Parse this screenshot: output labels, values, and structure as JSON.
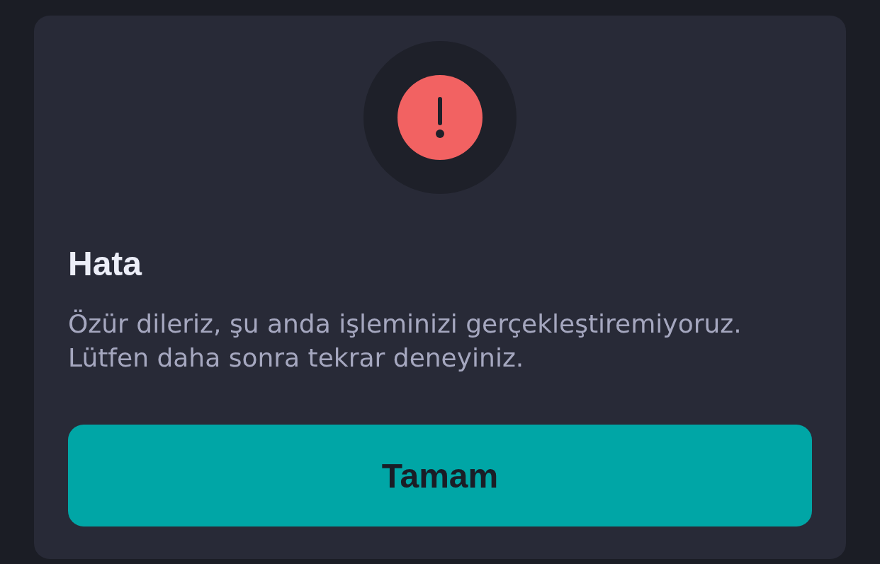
{
  "dialog": {
    "title": "Hata",
    "message": "Özür dileriz, şu anda işleminizi gerçekleştiremiyoruz. Lütfen daha sonra tekrar deneyiniz.",
    "button": "Tamam"
  }
}
